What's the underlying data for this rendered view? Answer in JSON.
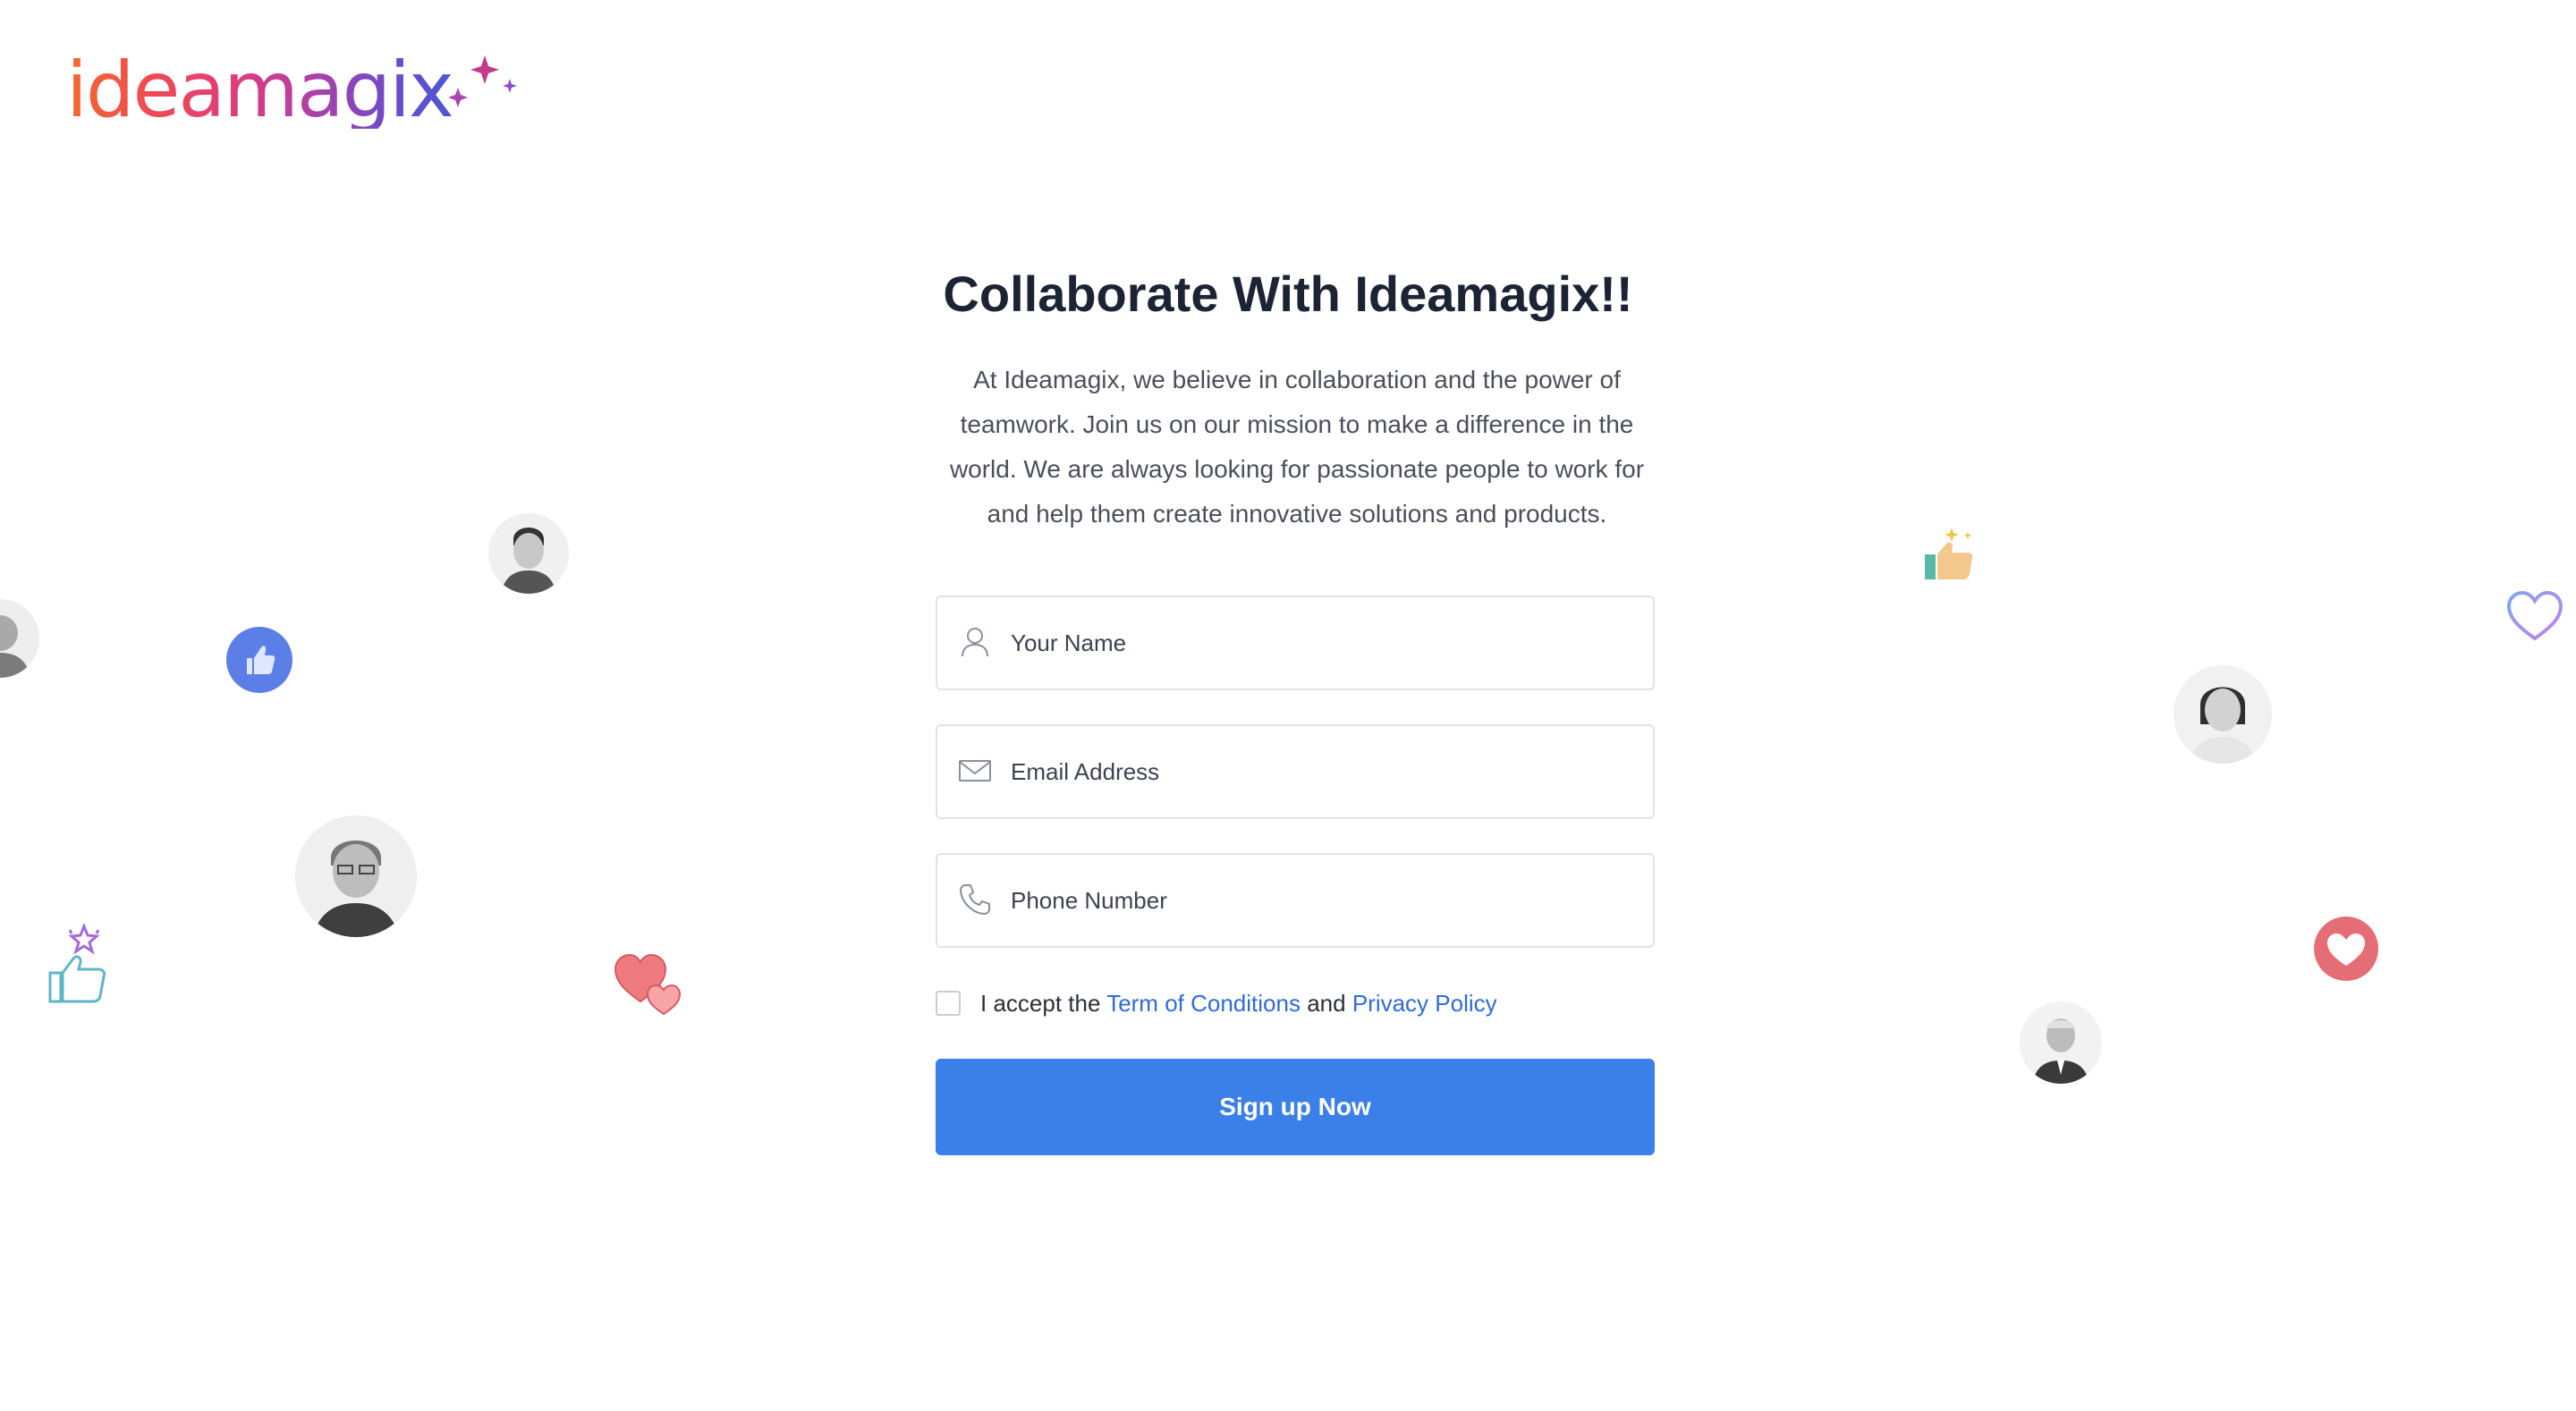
{
  "logo": {
    "text": "ideamagix",
    "icon": "sparkles-icon"
  },
  "hero": {
    "heading": "Collaborate With Ideamagix!!",
    "intro": "At Ideamagix, we believe in collaboration and the power of teamwork. Join us on our mission to make a difference in the world. We are always looking for passionate people to work for and help them create innovative solutions and products."
  },
  "form": {
    "name": {
      "placeholder": "Your Name",
      "icon": "user-icon"
    },
    "email": {
      "placeholder": "Email Address",
      "icon": "envelope-icon"
    },
    "phone": {
      "placeholder": "Phone Number",
      "icon": "phone-icon"
    },
    "terms": {
      "prefix": "I accept the",
      "terms_link": "Term of Conditions",
      "conjunction": "and",
      "privacy_link": "Privacy Policy",
      "checked": false
    },
    "submit_label": "Sign up Now"
  },
  "colors": {
    "primary": "#3b7fe8",
    "link": "#2f6bd8",
    "heading": "#1b2334",
    "body_text": "#4a4f5a",
    "border": "#e1e3e7"
  }
}
